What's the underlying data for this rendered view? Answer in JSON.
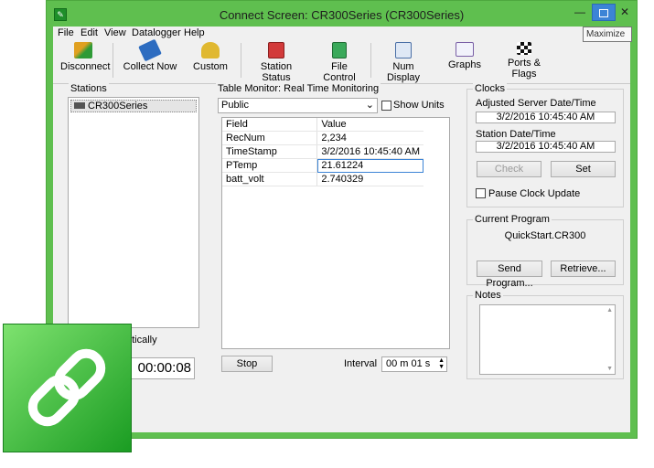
{
  "window": {
    "title": "Connect Screen: CR300Series (CR300Series)",
    "tooltip": "Maximize",
    "min_glyph": "—",
    "close_glyph": "✕"
  },
  "menu": [
    "File",
    "Edit",
    "View",
    "Datalogger",
    "Help"
  ],
  "toolbar": {
    "disconnect": "Disconnect",
    "collect_now": "Collect Now",
    "custom": "Custom",
    "station_status": "Station Status",
    "file_control": "File Control",
    "num_display": "Num Display",
    "graphs": "Graphs",
    "ports_flags": "Ports & Flags"
  },
  "stations": {
    "title": "Stations",
    "items": [
      "CR300Series"
    ],
    "partial_label": "etically",
    "partial_timer": "00:00:08"
  },
  "table_monitor": {
    "title": "Table Monitor: Real Time Monitoring",
    "selected_table": "Public",
    "show_units_label": "Show Units",
    "headers": [
      "Field",
      "Value"
    ],
    "rows": [
      {
        "field": "RecNum",
        "value": "2,234"
      },
      {
        "field": "TimeStamp",
        "value": "3/2/2016 10:45:40 AM"
      },
      {
        "field": "PTemp",
        "value": "21.61224"
      },
      {
        "field": "batt_volt",
        "value": "2.740329"
      }
    ],
    "stop_label": "Stop",
    "interval_label": "Interval",
    "interval_value": "00 m 01 s"
  },
  "clocks": {
    "title": "Clocks",
    "server_label": "Adjusted Server Date/Time",
    "server_value": "3/2/2016 10:45:40 AM",
    "station_label": "Station Date/Time",
    "station_value": "3/2/2016 10:45:40 AM",
    "check_label": "Check",
    "set_label": "Set",
    "pause_label": "Pause Clock Update"
  },
  "program": {
    "title": "Current Program",
    "name": "QuickStart.CR300",
    "send_label": "Send Program...",
    "retrieve_label": "Retrieve..."
  },
  "notes": {
    "title": "Notes"
  },
  "colors": {
    "window_frame": "#5fbf4f",
    "maximize_btn": "#3c84d6",
    "badge_green": "#2cbd2f",
    "selected_cell_border": "#3c84d6"
  }
}
